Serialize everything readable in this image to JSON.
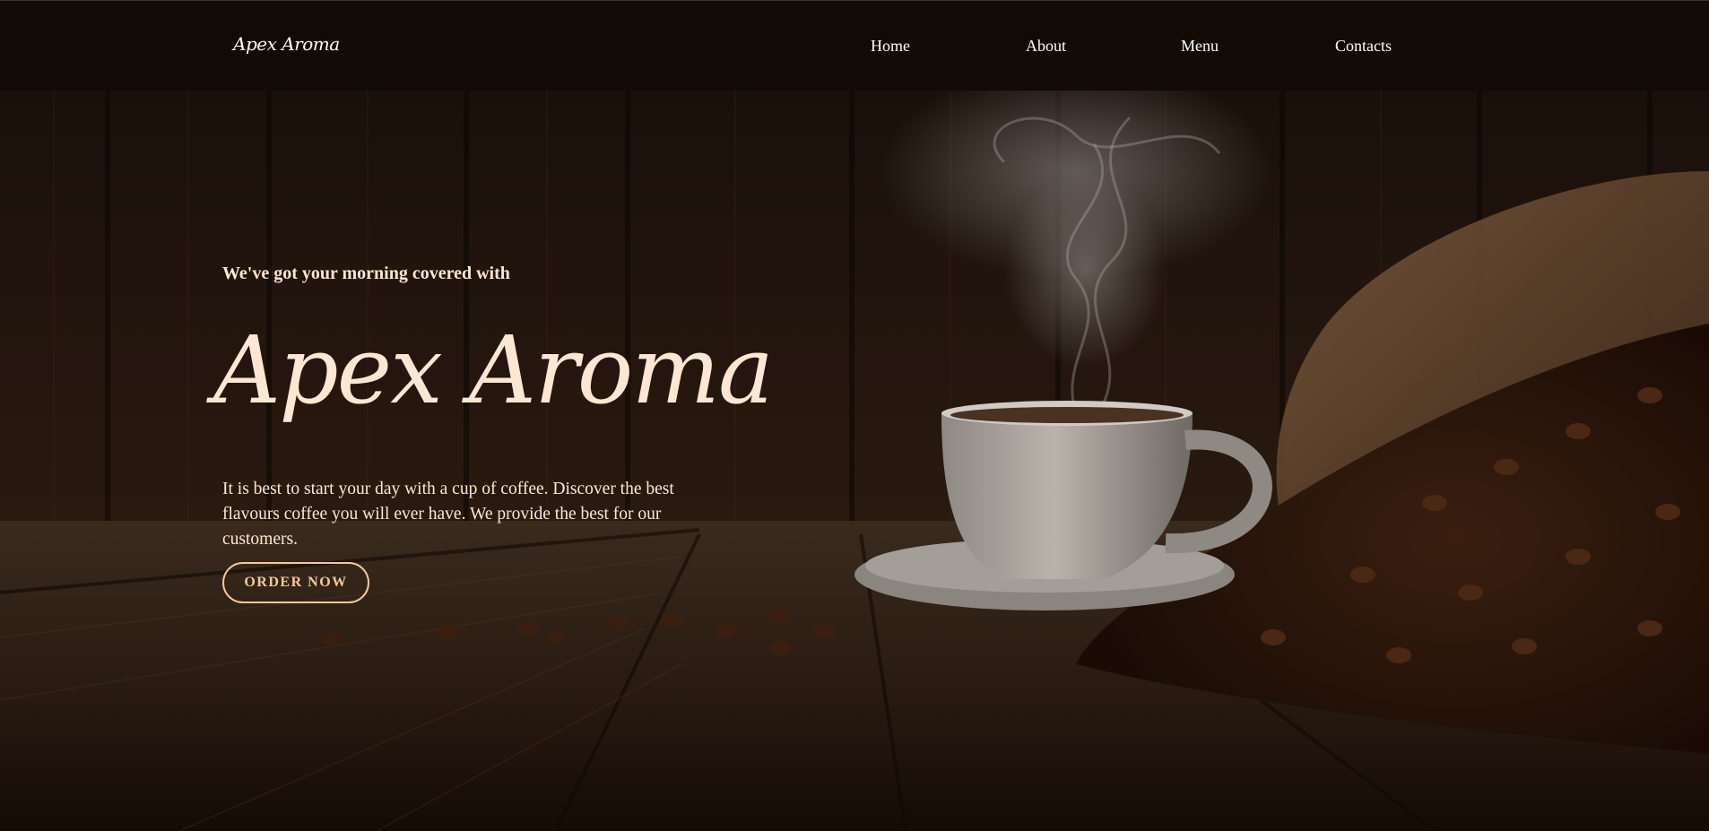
{
  "header": {
    "logo": "Apex Aroma",
    "nav": [
      {
        "label": "Home"
      },
      {
        "label": "About"
      },
      {
        "label": "Menu"
      },
      {
        "label": "Contacts"
      }
    ]
  },
  "hero": {
    "eyebrow": "We've got your morning covered with",
    "title": "Apex Aroma",
    "description": "It is best to start your day with a cup of coffee. Discover the best flavours coffee you will ever have. We provide the best for our customers.",
    "cta_label": "ORDER NOW"
  },
  "colors": {
    "header_bg": "#120a04",
    "accent": "#f5c99a",
    "text": "#fde7d2"
  }
}
